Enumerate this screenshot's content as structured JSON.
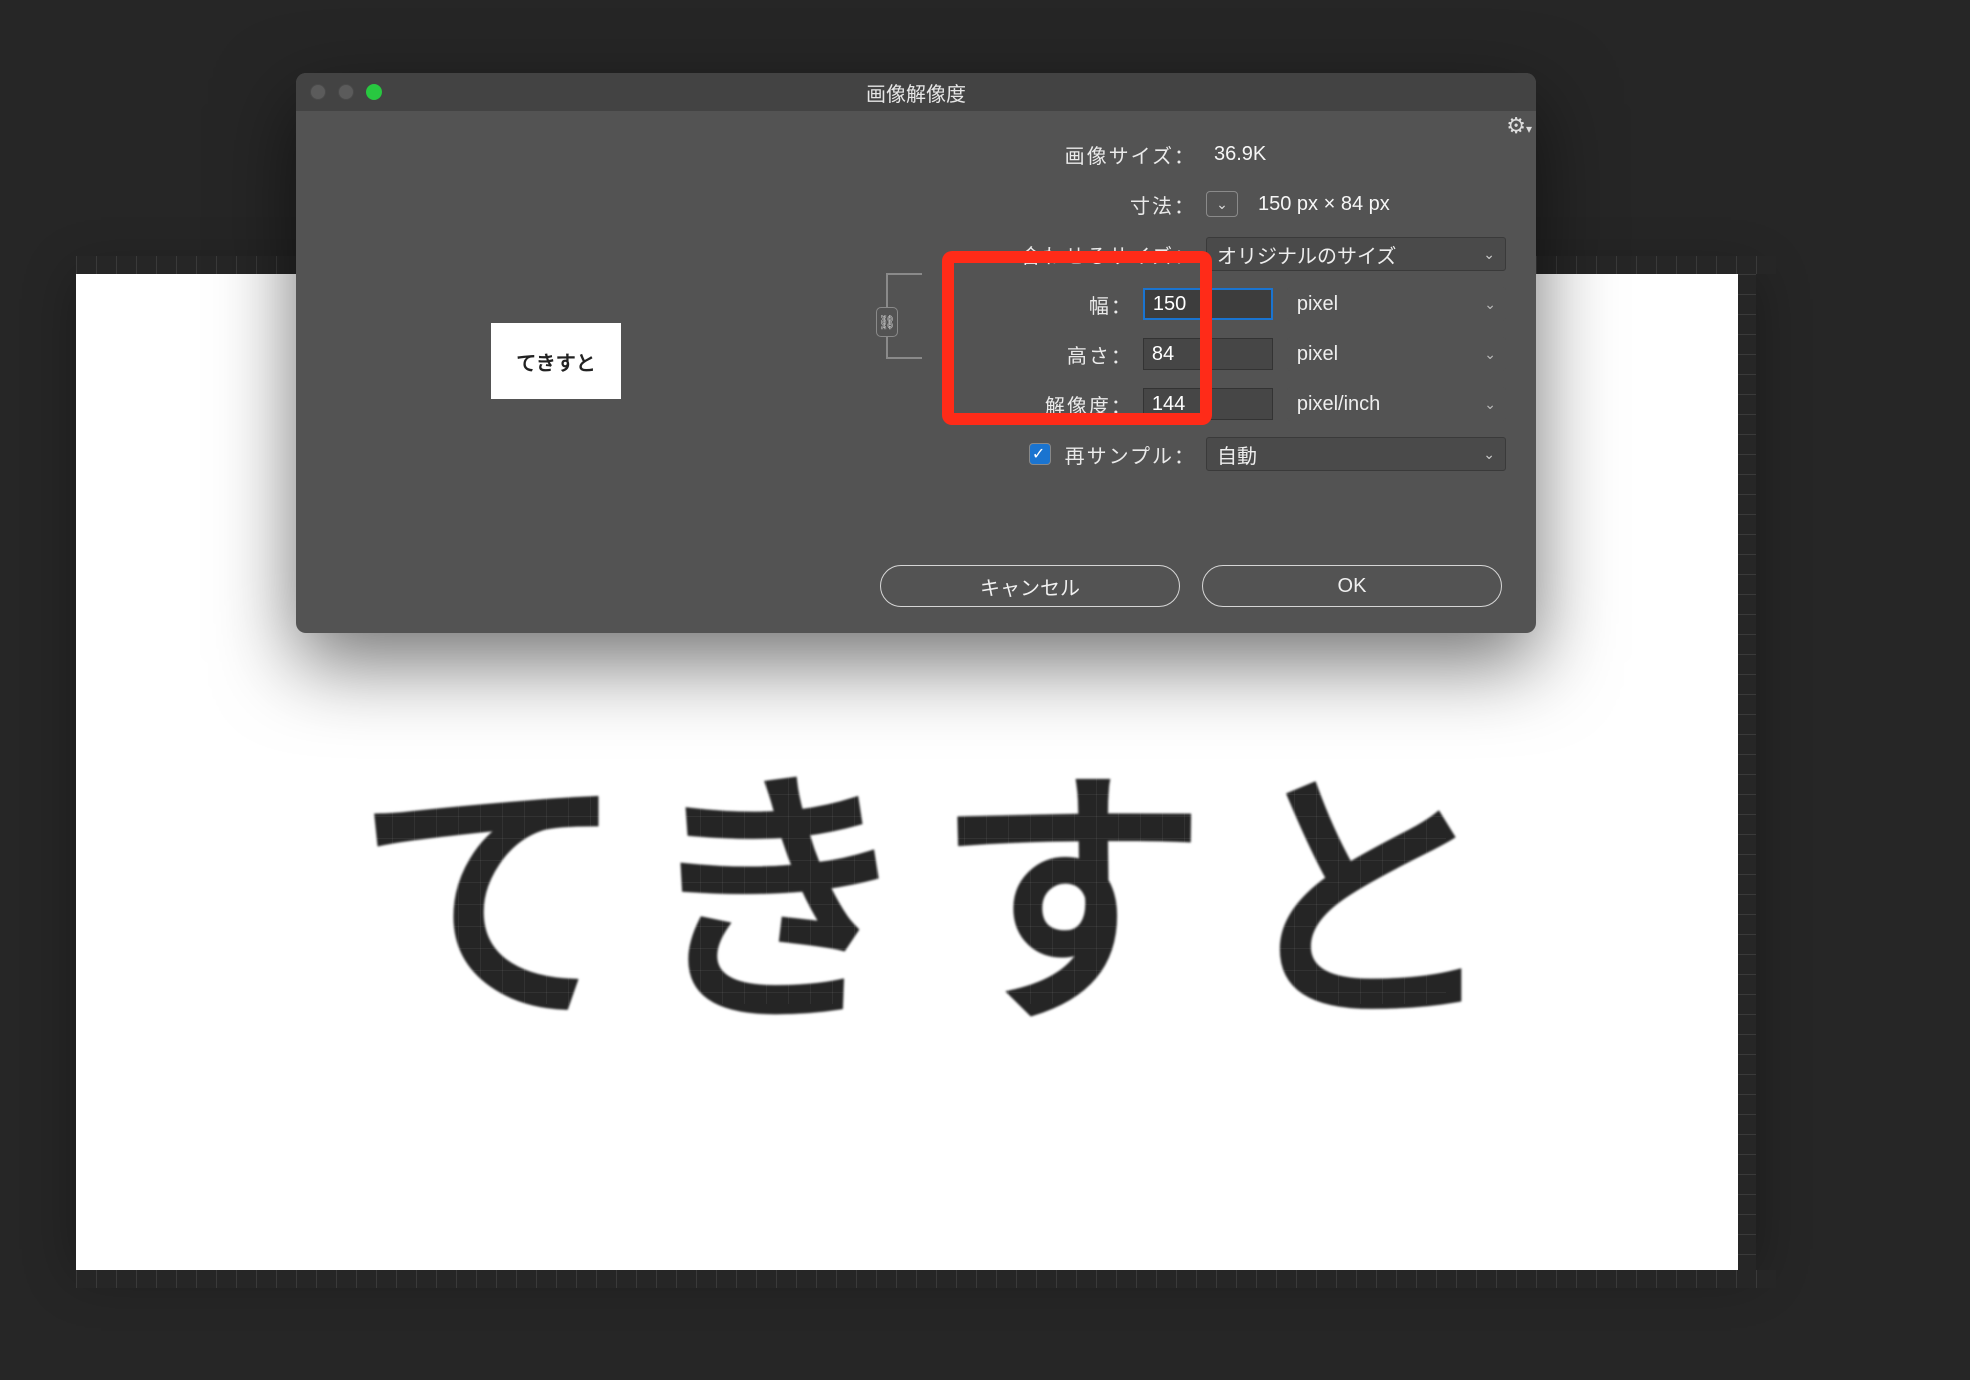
{
  "canvas": {
    "big_text": "てきすと"
  },
  "dialog": {
    "title": "画像解像度",
    "gear_icon": "gear",
    "image_size_label": "画像サイズ：",
    "image_size_value": "36.9K",
    "dimensions_label": "寸法：",
    "dimensions_value": "150 px × 84 px",
    "fit_label": "合わせるサイズ：",
    "fit_value": "オリジナルのサイズ",
    "width_label": "幅：",
    "width_value": "150",
    "width_unit": "pixel",
    "height_label": "高さ：",
    "height_value": "84",
    "height_unit": "pixel",
    "resolution_label": "解像度：",
    "resolution_value": "144",
    "resolution_unit": "pixel/inch",
    "resample_label": "再サンプル：",
    "resample_value": "自動",
    "cancel": "キャンセル",
    "ok": "OK",
    "preview_text": "てきすと"
  }
}
